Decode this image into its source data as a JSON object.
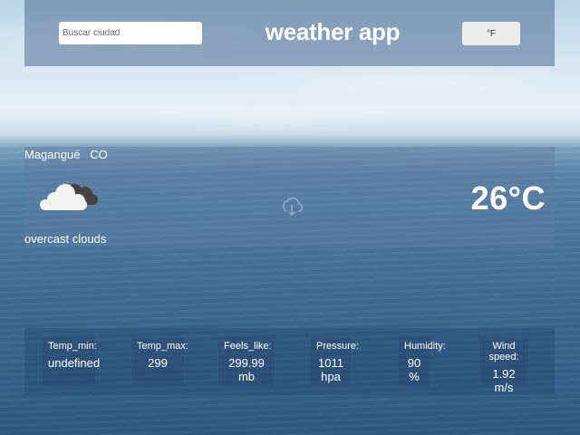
{
  "header": {
    "search_placeholder": "Buscar ciudad",
    "title": "weather app",
    "unit_toggle_label": "°F"
  },
  "current": {
    "city": "Magangué",
    "country": "CO",
    "icon": "overcast-clouds-icon",
    "description": "overcast clouds",
    "temperature": "26°C"
  },
  "stats": [
    {
      "label": "Temp_min:",
      "value": "undefined"
    },
    {
      "label": "Temp_max:",
      "value": "299"
    },
    {
      "label": "Feels_like:",
      "value": "299.99 mb"
    },
    {
      "label": "Pressure:",
      "value": "1011 hpa"
    },
    {
      "label": "Humidity:",
      "value": "90 %"
    },
    {
      "label": "Wind speed:",
      "value": "1.92 m/s"
    }
  ]
}
